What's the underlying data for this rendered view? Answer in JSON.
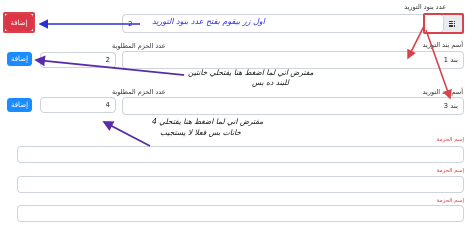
{
  "supply_count": {
    "label": "عدد بنود التوريد",
    "value": "2",
    "add_button": "إضافة"
  },
  "annotations": {
    "top": "اول زر بيقوم بفتح عدد بنود التوريد",
    "middle_line1": "مفترض اني لما اضغط هنا يفتحلي خانتين",
    "middle_line2": "للبند ده بس",
    "bottom_line1": "مفترض اني لما اضغط هنا يفتحلي 4",
    "bottom_line2": "خانات بس فعلا لا يستجيب"
  },
  "items": [
    {
      "name_label": "أسم بند التوريد",
      "name_value": "بند 1",
      "qty_label": "عدد الحزم المطلوبة",
      "qty_value": "2",
      "add_button": "إضافة"
    },
    {
      "name_label": "أسم بند التوريد",
      "name_value": "بند 3",
      "qty_label": "عدد الحزم المطلوبة",
      "qty_value": "4",
      "add_button": "إضافة"
    }
  ],
  "packages": [
    {
      "label": "إسم الحزمة"
    },
    {
      "label": "إسم الحزمة"
    },
    {
      "label": "إسم الحزمة"
    }
  ],
  "colors": {
    "red_button": "#dc3545",
    "blue_button": "#1a8cff",
    "blue_annotation": "#2b2fd8",
    "red_annotation": "#d8434b",
    "purple_arrow": "#5a2ca8"
  }
}
